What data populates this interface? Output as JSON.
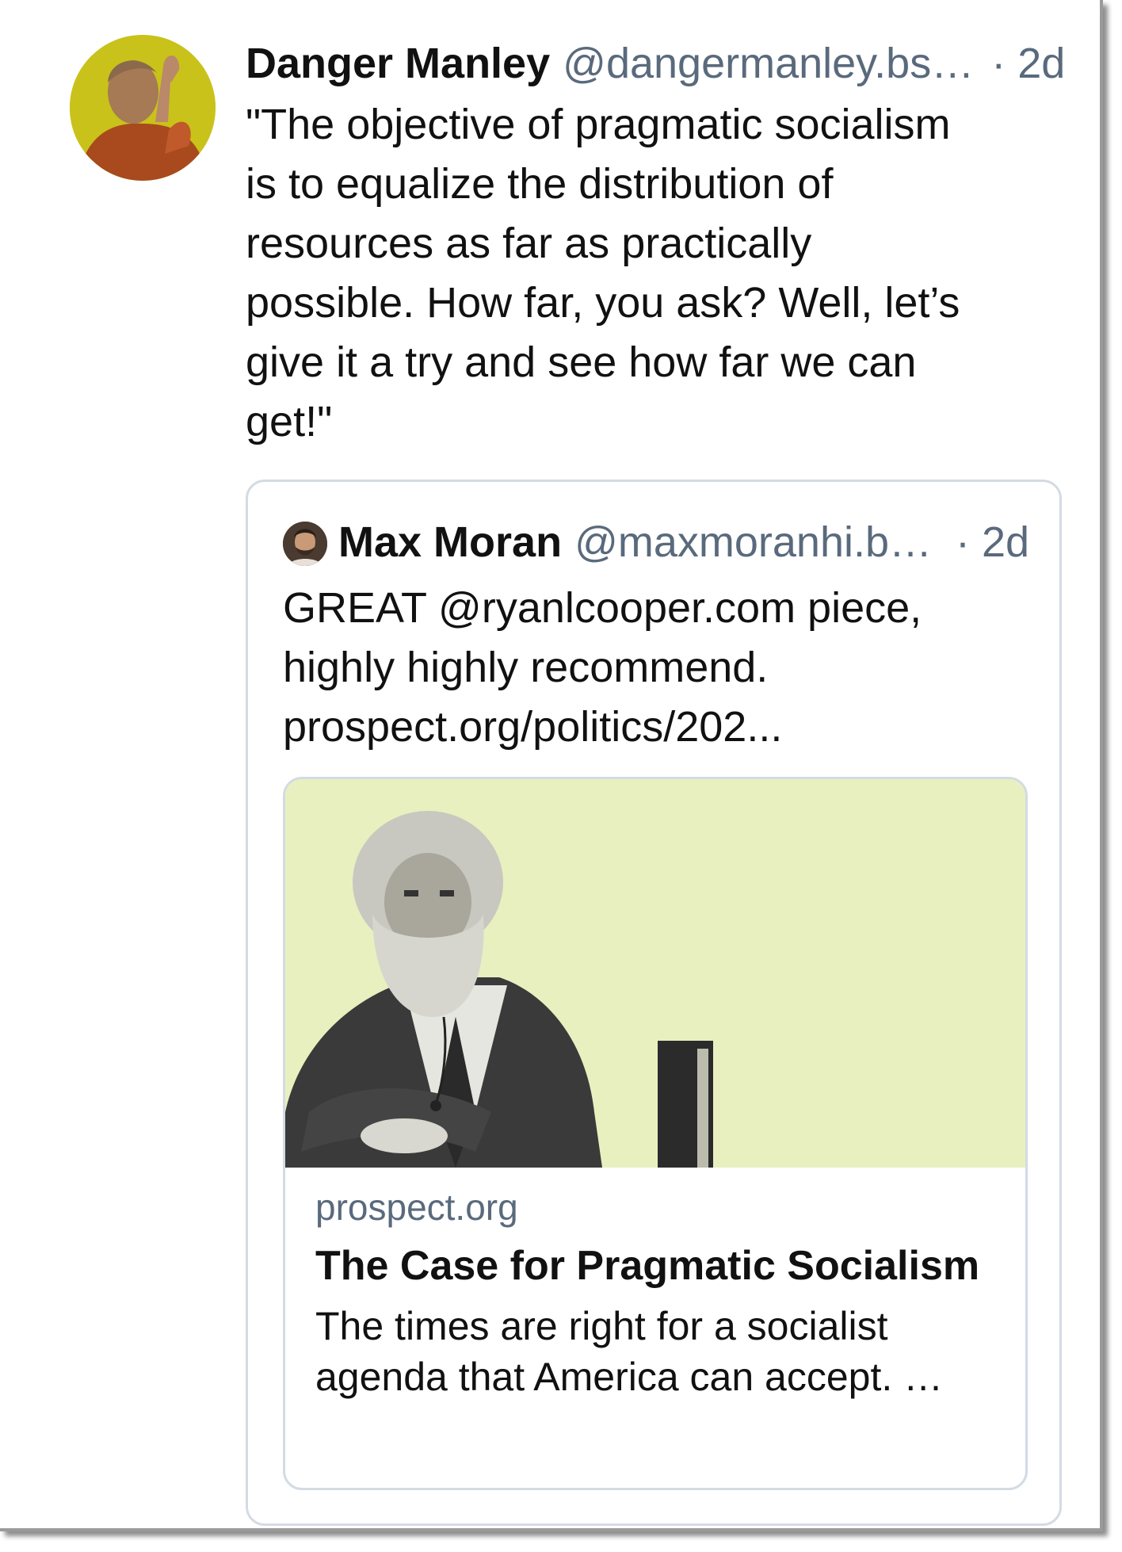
{
  "post": {
    "author_name": "Danger Manley",
    "author_handle": "@dangermanley.bs…",
    "time": "· 2d",
    "text": "\"The objective of pragmatic socialism\nis to equalize the distribution of\nresources as far as practically\npossible. How far, you ask? Well, let’s\ngive it a try and see how far we can\nget!\""
  },
  "quote": {
    "author_name": "Max Moran",
    "author_handle": "@maxmoranhi.b…",
    "time": "· 2d",
    "text": "GREAT @ryanlcooper.com piece,\nhighly highly recommend.\nprospect.org/politics/202...",
    "link_card": {
      "domain": "prospect.org",
      "title": "The Case for Pragmatic Socialism",
      "description_line1": "The times are right for a socialist",
      "description_line2": "agenda that America can accept. …"
    }
  },
  "colors": {
    "secondary_text": "#5a6a7d",
    "card_border": "#d3dbe4",
    "link_image_bg": "#e8f0bf",
    "avatar_bg": "#c9c21a"
  }
}
